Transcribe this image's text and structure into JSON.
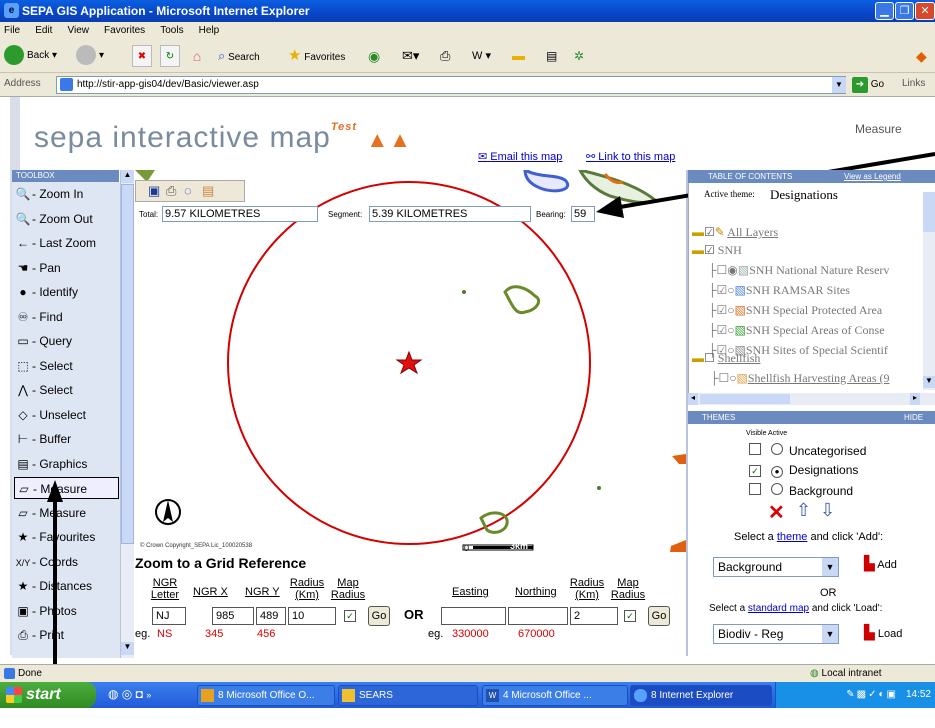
{
  "window": {
    "title": "SEPA GIS Application - Microsoft Internet Explorer"
  },
  "menu": [
    "File",
    "Edit",
    "View",
    "Favorites",
    "Tools",
    "Help"
  ],
  "toolbar": {
    "back": "Back",
    "search": "Search",
    "favorites": "Favorites"
  },
  "address": {
    "label": "Address",
    "url": "http://stir-app-gis04/dev/Basic/viewer.asp",
    "go": "Go",
    "links": "Links"
  },
  "header": {
    "logo_text": "sepa interactive map",
    "logo_badge": "Test",
    "mode": "Measure",
    "email_link": "Email this map",
    "link_link": "Link to this map"
  },
  "toolbox": {
    "title": "TOOLBOX",
    "items": [
      {
        "icon": "zoom-in-icon",
        "glyph": "🔍",
        "label": "- Zoom In"
      },
      {
        "icon": "zoom-out-icon",
        "glyph": "🔍",
        "label": "- Zoom Out"
      },
      {
        "icon": "last-zoom-icon",
        "glyph": "←",
        "label": "- Last Zoom"
      },
      {
        "icon": "pan-hand-icon",
        "glyph": "☚",
        "label": "- Pan"
      },
      {
        "icon": "identify-icon",
        "glyph": "●",
        "label": "- Identify"
      },
      {
        "icon": "binoculars-icon",
        "glyph": "♾",
        "label": "- Find"
      },
      {
        "icon": "query-icon",
        "glyph": "▭",
        "label": "- Query"
      },
      {
        "icon": "select-rect-icon",
        "glyph": "⬚",
        "label": "- Select"
      },
      {
        "icon": "select-line-icon",
        "glyph": "⋀",
        "label": "- Select"
      },
      {
        "icon": "eraser-icon",
        "glyph": "◇",
        "label": "- Unselect"
      },
      {
        "icon": "buffer-icon",
        "glyph": "⊢",
        "label": "- Buffer"
      },
      {
        "icon": "graphics-icon",
        "glyph": "▤",
        "label": "- Graphics"
      },
      {
        "icon": "measure-icon",
        "glyph": "▱",
        "label": "- Measure"
      },
      {
        "icon": "measure-icon",
        "glyph": "▱",
        "label": "- Measure"
      },
      {
        "icon": "star-icon",
        "glyph": "★",
        "label": "- Favourites"
      },
      {
        "icon": "xy-coords-icon",
        "glyph": "X/Y",
        "label": "- Coords"
      },
      {
        "icon": "star-distances-icon",
        "glyph": "★",
        "label": "- Distances"
      },
      {
        "icon": "photos-icon",
        "glyph": "▣",
        "label": "- Photos"
      },
      {
        "icon": "printer-icon",
        "glyph": "⎙",
        "label": "- Print"
      }
    ]
  },
  "measure": {
    "total_label": "Total:",
    "total_value": "9.57 KILOMETRES",
    "segment_label": "Segment:",
    "segment_value": "5.39 KILOMETRES",
    "bearing_label": "Bearing:",
    "bearing_value": "59"
  },
  "map": {
    "copyright": "© Crown Copyright_SEPA Lic_100020538",
    "scale_0": "0",
    "scale_end": "3km"
  },
  "grid": {
    "title": "Zoom to a Grid Reference",
    "h_ngr_letter": "NGR Letter",
    "h_ngr_x": "NGR X",
    "h_ngr_y": "NGR Y",
    "h_radius": "Radius (Km)",
    "h_map_radius": "Map Radius",
    "h_easting": "Easting",
    "h_northing": "Northing",
    "h_radius2": "Radius (Km)",
    "h_map_radius2": "Map Radius",
    "letter": "NJ",
    "x": "985",
    "y": "489",
    "radius": "10",
    "radius2": "2",
    "go": "Go",
    "or": "OR",
    "eg": "eg.",
    "eg_letter": "NS",
    "eg_x": "345",
    "eg_y": "456",
    "eg_easting": "330000",
    "eg_northing": "670000"
  },
  "toc": {
    "title": "TABLE OF CONTENTS",
    "view_legend": "View as Legend",
    "active_theme_label": "Active theme:",
    "active_theme": "Designations",
    "all_layers": "All Layers",
    "snh": "SNH",
    "layers": [
      "SNH National Nature Reserv",
      "SNH RAMSAR Sites",
      "SNH Special Protected Area",
      "SNH Special Areas of Conse",
      "SNH Sites of Special Scientif"
    ],
    "shellfish": "Shellfish",
    "shellfish_layer": "Shellfish Harvesting Areas (9"
  },
  "themes": {
    "title": "THEMES",
    "hide": "HIDE",
    "visible_active": "Visible Active",
    "items": [
      "Uncategorised",
      "Designations",
      "Background"
    ],
    "select_text_pre": "Select a ",
    "theme_link": "theme",
    "select_text_post": " and click 'Add':",
    "theme_select": "Background",
    "add": "Add",
    "or": "OR",
    "std_pre": "Select a ",
    "std_link": "standard map",
    "std_post": " and click 'Load':",
    "map_select": "Biodiv - Reg",
    "load": "Load"
  },
  "status": {
    "left": "Done",
    "zone": "Local intranet"
  },
  "taskbar": {
    "start": "start",
    "tasks": [
      "8 Microsoft Office O...",
      "SEARS",
      "4 Microsoft Office ...",
      "8 Internet Explorer"
    ],
    "clock": "14:52"
  }
}
